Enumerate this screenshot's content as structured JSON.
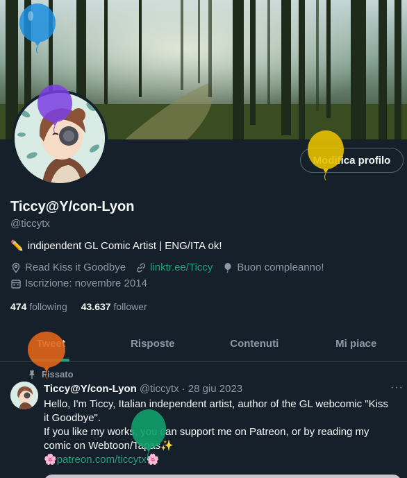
{
  "profile": {
    "name": "Ticcy@Y/con-Lyon",
    "handle": "@ticcytx",
    "bio_emoji": "✏️",
    "bio": "indipendent GL Comic Artist | ENG/ITA ok!",
    "location": "Read Kiss it Goodbye",
    "website": "linktr.ee/Ticcy",
    "birthday": "Buon compleanno!",
    "joined": "Iscrizione: novembre 2014",
    "following_count": "474",
    "following_label": "following",
    "followers_count": "43.637",
    "followers_label": "follower",
    "edit_button": "Modifica profilo"
  },
  "tabs": [
    {
      "label": "Tweet",
      "active": true
    },
    {
      "label": "Risposte",
      "active": false
    },
    {
      "label": "Contenuti",
      "active": false
    },
    {
      "label": "Mi piace",
      "active": false
    }
  ],
  "pinned_tweet": {
    "pinned_label": "Fissato",
    "author": "Ticcy@Y/con-Lyon",
    "handle": "@ticcytx",
    "separator": "·",
    "date": "28 giu 2023",
    "more": "···",
    "lines": [
      "Hello, I'm Ticcy, Italian independent artist, author of the GL webcomic \"Kiss",
      "it Goodbye\".",
      "If you like my works, you can support me on Patreon, or by reading my",
      "comic on Webtoon/Tapas✨"
    ],
    "link_prefix": "🌸",
    "link": "patreon.com/ticcytx",
    "link_suffix": "🌸"
  },
  "colors": {
    "background": "#15202b",
    "accent": "#1fa37a",
    "secondary_text": "#8b98a5",
    "balloon_blue": "#1d8fe0",
    "balloon_purple": "#7b3fe4",
    "balloon_yellow": "#e8c000",
    "balloon_orange": "#e0641a",
    "balloon_green": "#109e6a"
  },
  "icons": [
    "location-icon",
    "link-icon",
    "balloon-icon",
    "calendar-icon",
    "pin-icon",
    "more-icon"
  ]
}
